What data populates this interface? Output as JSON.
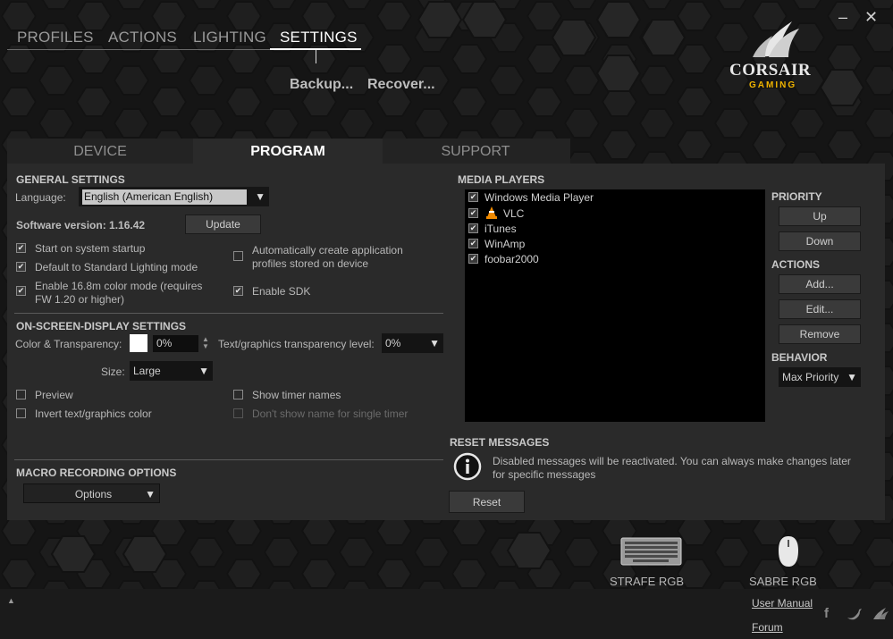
{
  "nav": {
    "profiles": "PROFILES",
    "actions": "ACTIONS",
    "lighting": "LIGHTING",
    "settings": "SETTINGS"
  },
  "sublinks": {
    "backup": "Backup...",
    "recover": "Recover..."
  },
  "window": {
    "minimize": "–",
    "close": "✕"
  },
  "brand": {
    "name": "CORSAIR",
    "tagline": "GAMING",
    "accent": "#f0b400"
  },
  "tabs": {
    "device": "DEVICE",
    "program": "PROGRAM",
    "support": "SUPPORT"
  },
  "general": {
    "title": "GENERAL SETTINGS",
    "language_label": "Language:",
    "language_value": "English (American English)",
    "version_label": "Software version: 1.16.42",
    "update": "Update",
    "startup": "Start on system startup",
    "default_lighting": "Default to Standard Lighting mode",
    "color_mode_1": "Enable 16.8m color mode (requires",
    "color_mode_2": "FW 1.20 or higher)",
    "auto_profiles_1": "Automatically create application",
    "auto_profiles_2": "profiles stored on device",
    "enable_sdk": "Enable SDK"
  },
  "osd": {
    "title": "ON-SCREEN-DISPLAY SETTINGS",
    "color_label": "Color & Transparency:",
    "color_swatch": "#ffffff",
    "transparency_value": "0%",
    "text_transp_label": "Text/graphics transparency level:",
    "text_transp_value": "0%",
    "size_label": "Size:",
    "size_value": "Large",
    "preview": "Preview",
    "show_timer": "Show timer names",
    "invert": "Invert text/graphics color",
    "dont_show": "Don't show name for single timer"
  },
  "macro": {
    "title": "MACRO RECORDING OPTIONS",
    "options": "Options"
  },
  "media": {
    "title": "MEDIA PLAYERS",
    "players": [
      "Windows Media Player",
      "VLC",
      "iTunes",
      "WinAmp",
      "foobar2000"
    ],
    "priority": "PRIORITY",
    "up": "Up",
    "down": "Down",
    "actions": "ACTIONS",
    "add": "Add...",
    "edit": "Edit...",
    "remove": "Remove",
    "behavior": "BEHAVIOR",
    "behavior_value": "Max Priority"
  },
  "reset": {
    "title": "RESET MESSAGES",
    "msg_1": "Disabled messages will be reactivated. You can always make changes later",
    "msg_2": "for specific messages",
    "button": "Reset"
  },
  "devices": {
    "keyboard": "STRAFE RGB",
    "mouse": "SABRE RGB"
  },
  "footer": {
    "manual": "User Manual",
    "forum": "Forum",
    "up_arrow": "▲"
  },
  "icons": [
    "minimize-icon",
    "close-icon",
    "corsair-sails-logo",
    "checkbox-checked-icon",
    "checkbox-empty-icon",
    "dropdown-arrow-icon",
    "spin-arrows-icon",
    "vlc-cone-icon",
    "info-icon",
    "keyboard-icon",
    "mouse-icon",
    "facebook-icon",
    "twitter-icon",
    "corsair-icon",
    "collapse-up-icon"
  ]
}
